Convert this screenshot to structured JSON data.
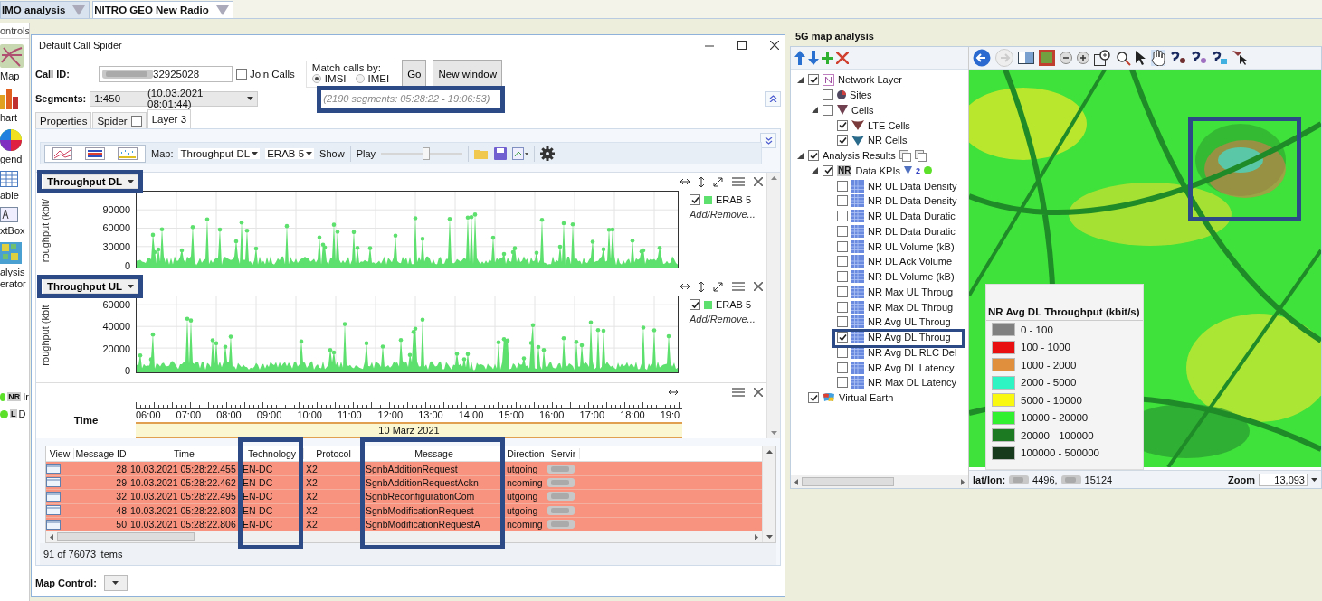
{
  "top_tabs": [
    {
      "label": "IMO analysis",
      "selected": false
    },
    {
      "label": "NITRO GEO New Radio",
      "selected": true
    }
  ],
  "controls_panel": {
    "title": "ontrols",
    "items": [
      {
        "kind": "map",
        "label": "Map"
      },
      {
        "kind": "chart",
        "label": "hart"
      },
      {
        "kind": "legend",
        "label": "gend"
      },
      {
        "kind": "table",
        "label": "able"
      },
      {
        "kind": "textbox",
        "label": "xtBox"
      },
      {
        "kind": "generator",
        "label": "alysis erator"
      }
    ],
    "layers": [
      {
        "badge": "NR",
        "label": "Ir"
      },
      {
        "badge": "L",
        "label": "D"
      }
    ]
  },
  "call_spider": {
    "title": "Default Call Spider",
    "call_id_label": "Call ID:",
    "call_id": "32925028",
    "join_calls": {
      "label": "Join Calls",
      "checked": false
    },
    "match": {
      "label": "Match calls by:",
      "options": [
        {
          "label": "IMSI",
          "selected": true
        },
        {
          "label": "IMEI",
          "selected": false
        }
      ]
    },
    "buttons": [
      "Go",
      "New window"
    ],
    "segments_label": "Segments:",
    "segment": "1:450",
    "segment_time": "(10.03.2021 08:01:44)",
    "segments_info": "(2190 segments: 05:28:22 - 19:06:53)",
    "tabs": [
      {
        "label": "Properties",
        "selected": false
      },
      {
        "label": "Spider",
        "selected": false,
        "checked": false
      },
      {
        "label": "Layer 3",
        "selected": true
      }
    ],
    "toolbar": {
      "map_label": "Map:",
      "map_value": "Throughput DL",
      "erab": "ERAB 5",
      "show": "Show",
      "play": "Play",
      "level": 0.55
    },
    "charts": [
      {
        "title": "Throughput DL",
        "ylabel": "roughput (kbit/",
        "yticks": [
          "90000",
          "60000",
          "30000",
          "0"
        ],
        "legend": {
          "label": "ERAB 5",
          "checked": true,
          "color": "#5ee06e"
        },
        "link": "Add/Remove..."
      },
      {
        "title": "Throughput UL",
        "ylabel": "roughput (kbit",
        "yticks": [
          "60000",
          "40000",
          "20000",
          "0"
        ],
        "legend": {
          "label": "ERAB 5",
          "checked": true,
          "color": "#5ee06e"
        },
        "link": "Add/Remove..."
      }
    ],
    "time_axis": {
      "label": "Time",
      "ticks": [
        "06:00",
        "07:00",
        "08:00",
        "09:00",
        "10:00",
        "11:00",
        "12:00",
        "13:00",
        "14:00",
        "15:00",
        "16:00",
        "17:00",
        "18:00",
        "19:0"
      ],
      "date": "10 März 2021"
    },
    "table": {
      "columns": [
        "View",
        "Message ID",
        "Time",
        "Technology",
        "Protocol",
        "Message",
        "Direction",
        "Servir"
      ],
      "rows": [
        {
          "id": "28",
          "time": "10.03.2021 05:28:22.455",
          "technology": "EN-DC",
          "protocol": "X2",
          "message": "SgnbAdditionRequest",
          "direction": "utgoing"
        },
        {
          "id": "29",
          "time": "10.03.2021 05:28:22.462",
          "technology": "EN-DC",
          "protocol": "X2",
          "message": "SgnbAdditionRequestAckn",
          "direction": "ncoming"
        },
        {
          "id": "32",
          "time": "10.03.2021 05:28:22.495",
          "technology": "EN-DC",
          "protocol": "X2",
          "message": "SgnbReconfigurationCom",
          "direction": "utgoing"
        },
        {
          "id": "48",
          "time": "10.03.2021 05:28:22.803",
          "technology": "EN-DC",
          "protocol": "X2",
          "message": "SgnbModificationRequest",
          "direction": "utgoing"
        },
        {
          "id": "50",
          "time": "10.03.2021 05:28:22.806",
          "technology": "EN-DC",
          "protocol": "X2",
          "message": "SgnbModificationRequestA",
          "direction": "ncoming"
        }
      ],
      "footer": "91 of 76073 items"
    },
    "map_control_label": "Map Control:"
  },
  "map_panel": {
    "title": "5G map analysis",
    "tree": [
      {
        "kind": "layer",
        "label": "Network Layer",
        "checked": true,
        "expanded": true,
        "children": [
          {
            "kind": "sites",
            "label": "Sites",
            "checked": false
          },
          {
            "kind": "cells",
            "label": "Cells",
            "checked": false,
            "expanded": true,
            "children": [
              {
                "kind": "lte",
                "label": "LTE Cells",
                "checked": true
              },
              {
                "kind": "nr",
                "label": "NR Cells",
                "checked": true
              }
            ]
          }
        ]
      },
      {
        "kind": "results",
        "label": "Analysis Results",
        "checked": true,
        "expanded": true,
        "children": [
          {
            "kind": "kpi_group",
            "badge": "NR",
            "label": "Data KPIs",
            "count": "2",
            "checked": true,
            "expanded": true,
            "children": [
              {
                "kind": "kpi",
                "label": "NR UL Data Density",
                "checked": false
              },
              {
                "kind": "kpi",
                "label": "NR DL Data Density",
                "checked": false
              },
              {
                "kind": "kpi",
                "label": "NR UL Data Duratic",
                "checked": false
              },
              {
                "kind": "kpi",
                "label": "NR DL Data Duratic",
                "checked": false
              },
              {
                "kind": "kpi",
                "label": "NR UL Volume (kB)",
                "checked": false
              },
              {
                "kind": "kpi",
                "label": "NR DL Ack Volume",
                "checked": false
              },
              {
                "kind": "kpi",
                "label": "NR DL Volume (kB)",
                "checked": false
              },
              {
                "kind": "kpi",
                "label": "NR Max UL Throug",
                "checked": false
              },
              {
                "kind": "kpi",
                "label": "NR Max DL Throug",
                "checked": false
              },
              {
                "kind": "kpi",
                "label": "NR Avg UL Throug",
                "checked": false
              },
              {
                "kind": "kpi",
                "label": "NR Avg DL Throug",
                "checked": true
              },
              {
                "kind": "kpi",
                "label": "NR Avg DL RLC Del",
                "checked": false
              },
              {
                "kind": "kpi",
                "label": "NR Avg DL Latency",
                "checked": false
              },
              {
                "kind": "kpi",
                "label": "NR Max DL Latency",
                "checked": false
              }
            ]
          }
        ]
      },
      {
        "kind": "earth",
        "label": "Virtual Earth",
        "checked": true
      }
    ],
    "legend": {
      "title": "NR Avg DL Throughput (kbit/s)",
      "items": [
        {
          "label": "0 - 100",
          "color": "#808080"
        },
        {
          "label": "100 - 1000",
          "color": "#e81010"
        },
        {
          "label": "1000 - 2000",
          "color": "#e0903c"
        },
        {
          "label": "2000 - 5000",
          "color": "#2ef4c4"
        },
        {
          "label": "5000 - 10000",
          "color": "#f8f810"
        },
        {
          "label": "10000 - 20000",
          "color": "#30f030"
        },
        {
          "label": "20000 - 100000",
          "color": "#1c7a22"
        },
        {
          "label": "100000 - 500000",
          "color": "#183a1c"
        }
      ]
    },
    "latlon_label": "lat/lon:",
    "lat": "4496,",
    "lon": "15124",
    "zoom_label": "Zoom",
    "zoom": "13,093"
  }
}
